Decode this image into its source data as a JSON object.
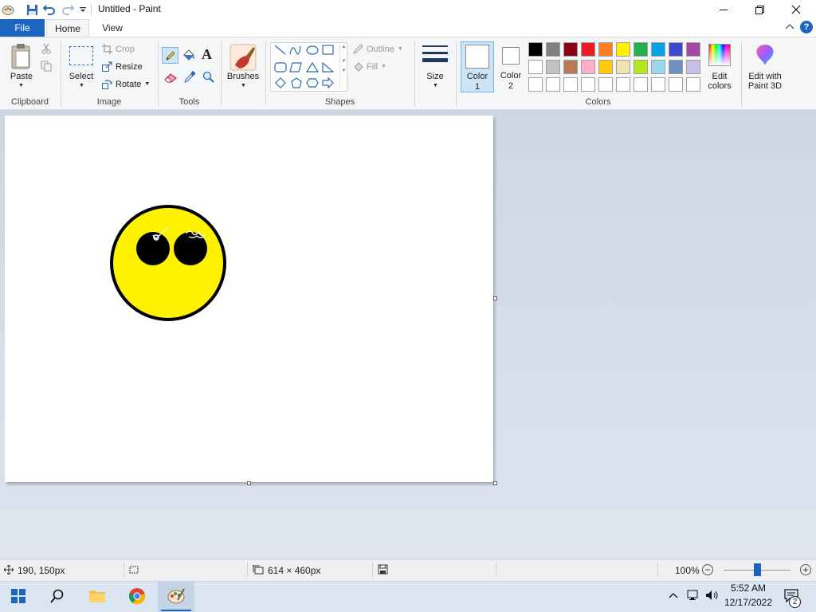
{
  "window": {
    "title": "Untitled - Paint",
    "controls": {
      "minimize": "—",
      "maximize": "❐",
      "close": "✕"
    },
    "quick_access": [
      "save-icon",
      "undo-icon",
      "redo-icon",
      "customize-quick-access-icon"
    ]
  },
  "tabs": {
    "file": "File",
    "home": "Home",
    "view": "View"
  },
  "ribbon": {
    "clipboard": {
      "label": "Clipboard",
      "paste": "Paste",
      "cut_icon": "scissors-icon",
      "copy_icon": "copy-icon"
    },
    "image": {
      "label": "Image",
      "select": "Select",
      "crop": "Crop",
      "resize": "Resize",
      "rotate": "Rotate"
    },
    "tools": {
      "label": "Tools",
      "items": [
        "pencil-icon",
        "fill-icon",
        "text-icon",
        "eraser-icon",
        "color-picker-icon",
        "magnifier-icon"
      ],
      "text_glyph": "A"
    },
    "brushes": {
      "label": "Brushes"
    },
    "shapes": {
      "label": "Shapes",
      "outline": "Outline",
      "fill": "Fill"
    },
    "size": {
      "label": "Size"
    },
    "color1": {
      "label": "Color",
      "number": "1"
    },
    "color2": {
      "label": "Color",
      "number": "2"
    },
    "colors": {
      "label": "Colors",
      "row1": [
        "#000000",
        "#7f7f7f",
        "#880015",
        "#ed1c24",
        "#ff7f27",
        "#fff200",
        "#22b14c",
        "#00a2e8",
        "#3f48cc",
        "#a349a4"
      ],
      "row2": [
        "#ffffff",
        "#c3c3c3",
        "#b97a57",
        "#ffaec9",
        "#ffc90e",
        "#efe4b0",
        "#b5e61d",
        "#99d9ea",
        "#7092be",
        "#c8bfe7"
      ],
      "row3": [
        "#ffffff",
        "#ffffff",
        "#ffffff",
        "#ffffff",
        "#ffffff",
        "#ffffff",
        "#ffffff",
        "#ffffff",
        "#ffffff",
        "#ffffff"
      ],
      "color1_value": "#ffffff",
      "color2_value": "#ffffff"
    },
    "edit_colors": {
      "line1": "Edit",
      "line2": "colors"
    },
    "paint3d": {
      "line1": "Edit with",
      "line2": "Paint 3D"
    }
  },
  "canvas": {
    "background": "#ffffff",
    "drawing": {
      "face_color": "#fff200",
      "outline_color": "#000000",
      "eye_color": "#000000"
    }
  },
  "status": {
    "cursor_pos": "190, 150px",
    "canvas_size": "614 × 460px",
    "zoom": "100%",
    "zoom_level_percent": 100
  },
  "taskbar": {
    "apps": [
      "start-icon",
      "search-icon",
      "file-explorer-icon",
      "chrome-icon",
      "paint-icon"
    ],
    "time": "5:52 AM",
    "date": "12/17/2022",
    "notifications": "2"
  }
}
